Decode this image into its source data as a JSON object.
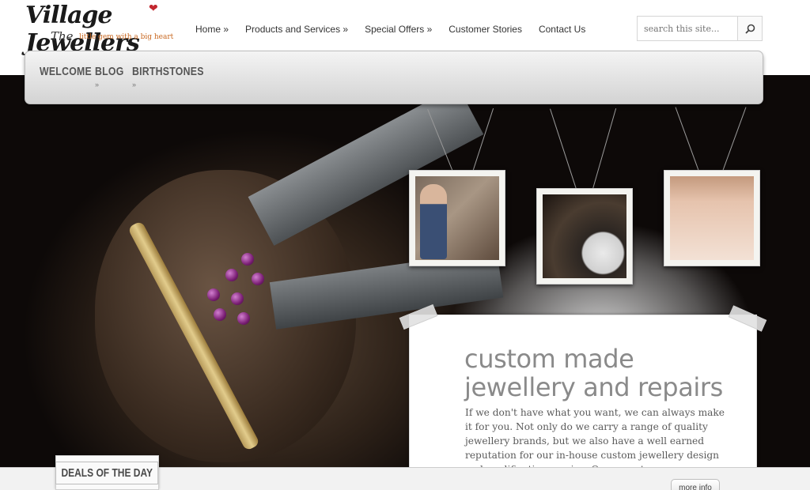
{
  "logo": {
    "main": "Village Jewellers",
    "the": "The",
    "tagline": "little gem with a big heart"
  },
  "topnav": {
    "items": [
      "Home »",
      "Products and Services »",
      "Special Offers »",
      "Customer Stories",
      "Contact Us"
    ]
  },
  "search": {
    "placeholder": "search this site...",
    "icon": "search-icon"
  },
  "menubar": {
    "items": [
      "WELCOME",
      "BLOG",
      "BIRTHSTONES"
    ],
    "arrow": "»"
  },
  "hero": {
    "heading_line1": "custom made",
    "heading_line2": "jewellery and repairs",
    "body": "If we don't have what you want, we can always make it for you. Not only do we carry a range of quality jewellery brands, but we also have a well earned reputation for our in-house custom jewellery design and modification service. Our expert..."
  },
  "footer": {
    "deals_label": "DEALS OF THE DAY",
    "more_info": "more info"
  },
  "colors": {
    "accent_heart": "#c2262e",
    "tagline": "#c8661e",
    "heading_grey": "#8a8a8a"
  }
}
